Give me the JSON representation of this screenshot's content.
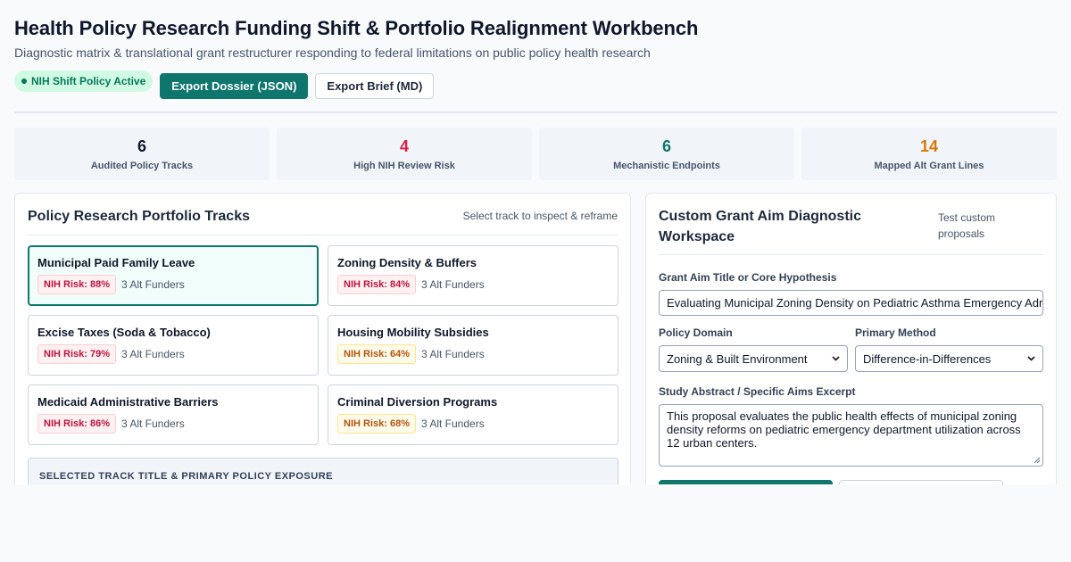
{
  "header": {
    "title": "Health Policy Research Funding Shift & Portfolio Realignment Workbench",
    "subtitle": "Diagnostic matrix & translational grant restructurer responding to federal limitations on public policy health research",
    "status_badge": "NIH Shift Policy Active",
    "export_json_label": "Export Dossier (JSON)",
    "export_md_label": "Export Brief (MD)"
  },
  "stats": [
    {
      "value": "6",
      "label": "Audited Policy Tracks",
      "color": "#0f172a"
    },
    {
      "value": "4",
      "label": "High NIH Review Risk",
      "color": "#e11d48"
    },
    {
      "value": "6",
      "label": "Mechanistic Endpoints",
      "color": "#0f766e"
    },
    {
      "value": "14",
      "label": "Mapped Alt Grant Lines",
      "color": "#d97706"
    }
  ],
  "portfolio": {
    "title": "Policy Research Portfolio Tracks",
    "hint": "Select track to inspect & reframe",
    "tracks": [
      {
        "name": "Municipal Paid Family Leave",
        "risk": "NIH Risk: 88%",
        "risk_level": "high",
        "funders": "3 Alt Funders",
        "selected": true
      },
      {
        "name": "Zoning Density & Buffers",
        "risk": "NIH Risk: 84%",
        "risk_level": "high",
        "funders": "3 Alt Funders",
        "selected": false
      },
      {
        "name": "Excise Taxes (Soda & Tobacco)",
        "risk": "NIH Risk: 79%",
        "risk_level": "high",
        "funders": "3 Alt Funders",
        "selected": false
      },
      {
        "name": "Housing Mobility Subsidies",
        "risk": "NIH Risk: 64%",
        "risk_level": "med",
        "funders": "3 Alt Funders",
        "selected": false
      },
      {
        "name": "Medicaid Administrative Barriers",
        "risk": "NIH Risk: 86%",
        "risk_level": "high",
        "funders": "3 Alt Funders",
        "selected": false
      },
      {
        "name": "Criminal Diversion Programs",
        "risk": "NIH Risk: 68%",
        "risk_level": "med",
        "funders": "3 Alt Funders",
        "selected": false
      }
    ],
    "selected_section_label": "SELECTED TRACK TITLE & PRIMARY POLICY EXPOSURE"
  },
  "workspace": {
    "title": "Custom Grant Aim Diagnostic Workspace",
    "hint": "Test custom proposals",
    "aim_label": "Grant Aim Title or Core Hypothesis",
    "aim_value": "Evaluating Municipal Zoning Density on Pediatric Asthma Emergency Admissions",
    "domain_label": "Policy Domain",
    "domain_value": "Zoning & Built Environment",
    "method_label": "Primary Method",
    "method_value": "Difference-in-Differences",
    "abstract_label": "Study Abstract / Specific Aims Excerpt",
    "abstract_value": "This proposal evaluates the public health effects of municipal zoning density reforms on pediatric emergency department utilization across 12 urban centers."
  }
}
